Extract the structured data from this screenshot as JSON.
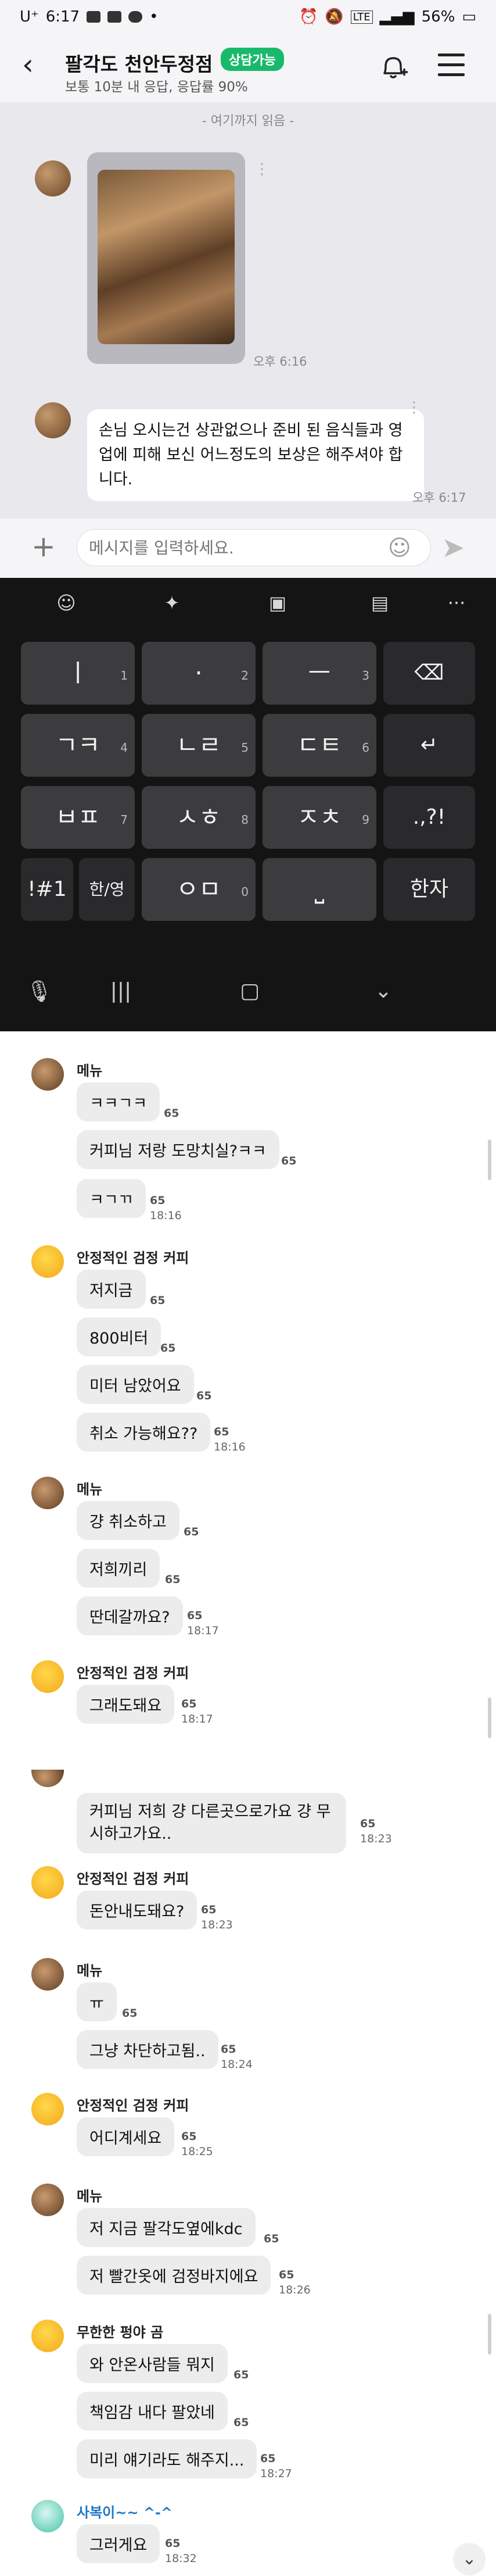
{
  "status_bar": {
    "carrier": "U⁺",
    "time": "6:17",
    "battery": "56%",
    "icons": [
      "gallery-icon",
      "calendar-icon",
      "cloud-icon",
      "dot-icon",
      "alarm-icon",
      "mute-icon",
      "lte-icon",
      "signal-icon",
      "battery-icon"
    ]
  },
  "header": {
    "back_icon": "back-arrow-icon",
    "title": "팔각도 천안두정점",
    "badge": "상담가능",
    "subtitle": "보통 10분 내 응답, 응답률 90%",
    "actions": [
      "bell-add-icon",
      "menu-icon"
    ]
  },
  "chat": {
    "read_divider": "- 여기까지 읽음 -",
    "image_time": "오후 6:16",
    "message_text": "손님 오시는건 상관없으나 준비 된 음식들과 영업에 피해 보신 어느정도의 보상은 해주셔야 합니다.",
    "message_time": "오후 6:17"
  },
  "input_bar": {
    "placeholder": "메시지를 입력하세요.",
    "icons": [
      "plus-icon",
      "emoji-icon",
      "send-icon"
    ]
  },
  "keyboard": {
    "toolbar": [
      "emoji-face-icon",
      "sparkle-icon",
      "sticker-icon",
      "clipboard-icon",
      "more-icon"
    ],
    "rows": [
      [
        {
          "label": "ㅣ",
          "num": "1"
        },
        {
          "label": "·",
          "num": "2"
        },
        {
          "label": "ㅡ",
          "num": "3"
        },
        {
          "label": "⌫",
          "num": ""
        }
      ],
      [
        {
          "label": "ㄱㅋ",
          "num": "4"
        },
        {
          "label": "ㄴㄹ",
          "num": "5"
        },
        {
          "label": "ㄷㅌ",
          "num": "6"
        },
        {
          "label": "↵",
          "num": ""
        }
      ],
      [
        {
          "label": "ㅂㅍ",
          "num": "7"
        },
        {
          "label": "ㅅㅎ",
          "num": "8"
        },
        {
          "label": "ㅈㅊ",
          "num": "9"
        },
        {
          "label": ".,?!",
          "num": ""
        }
      ],
      [
        {
          "label": "!#1",
          "num": ""
        },
        {
          "label": "한/영",
          "num": ""
        },
        {
          "label": "ㅇㅁ",
          "num": "0"
        },
        {
          "label": "⎵",
          "num": ""
        },
        {
          "label": "한자",
          "num": ""
        }
      ]
    ],
    "nav": [
      "mic-icon",
      "recents-icon",
      "home-icon",
      "hide-keyboard-icon"
    ]
  },
  "lower_chat": {
    "groups": [
      {
        "name": "메뉴",
        "avatar": "food",
        "messages": [
          {
            "text": "ㅋㅋㄱㅋ",
            "count": "65"
          },
          {
            "text": "커피님 저랑 도망치실?ㅋㅋ",
            "count": "65"
          },
          {
            "text": "ㅋㄱㄲ",
            "count": "65",
            "time": "18:16"
          }
        ]
      },
      {
        "name": "안정적인 검정 커피",
        "avatar": "emoji",
        "messages": [
          {
            "text": "저지금",
            "count": "65"
          },
          {
            "text": "800비터",
            "count": "65"
          },
          {
            "text": "미터 남았어요",
            "count": "65"
          },
          {
            "text": "취소 가능해요??",
            "count": "65",
            "time": "18:16"
          }
        ]
      },
      {
        "name": "메뉴",
        "avatar": "food",
        "messages": [
          {
            "text": "걍 취소하고",
            "count": "65"
          },
          {
            "text": "저희끼리",
            "count": "65"
          },
          {
            "text": "딴데갈까요?",
            "count": "65",
            "time": "18:17"
          }
        ]
      },
      {
        "name": "안정적인 검정 커피",
        "avatar": "emoji",
        "messages": [
          {
            "text": "그래도돼요",
            "count": "65",
            "time": "18:17"
          }
        ]
      },
      {
        "name": "",
        "avatar": "food",
        "messages": [
          {
            "text": "커피님 저희 걍 다른곳으로가요 걍 무시하고가요..",
            "count": "65",
            "time": "18:23"
          }
        ]
      },
      {
        "name": "안정적인 검정 커피",
        "avatar": "emoji",
        "messages": [
          {
            "text": "돈안내도돼요?",
            "count": "65",
            "time": "18:23"
          }
        ]
      },
      {
        "name": "메뉴",
        "avatar": "food",
        "messages": [
          {
            "text": "ㅠ",
            "count": "65"
          },
          {
            "text": "그냥 차단하고됨..",
            "count": "65",
            "time": "18:24"
          }
        ]
      },
      {
        "name": "안정적인 검정 커피",
        "avatar": "emoji",
        "messages": [
          {
            "text": "어디계세요",
            "count": "65",
            "time": "18:25"
          }
        ]
      },
      {
        "name": "메뉴",
        "avatar": "food",
        "messages": [
          {
            "text": "저 지금 팔각도옆에kdc",
            "count": "65"
          },
          {
            "text": "저 빨간옷에 검정바지에요",
            "count": "65",
            "time": "18:26"
          }
        ]
      },
      {
        "name": "무한한 펑야 곰",
        "avatar": "emoji",
        "messages": [
          {
            "text": "와 안온사람들 뭐지",
            "count": "65"
          },
          {
            "text": "책임감 내다 팔았네",
            "count": "65"
          },
          {
            "text": "미리 얘기라도 해주지...",
            "count": "65",
            "time": "18:27"
          }
        ]
      },
      {
        "name": "사복이~~ ^-^",
        "avatar": "teal",
        "messages": [
          {
            "text": "그러게요",
            "count": "65",
            "time": "18:32"
          }
        ]
      }
    ],
    "scroll_down_icon": "chevron-down-icon"
  }
}
